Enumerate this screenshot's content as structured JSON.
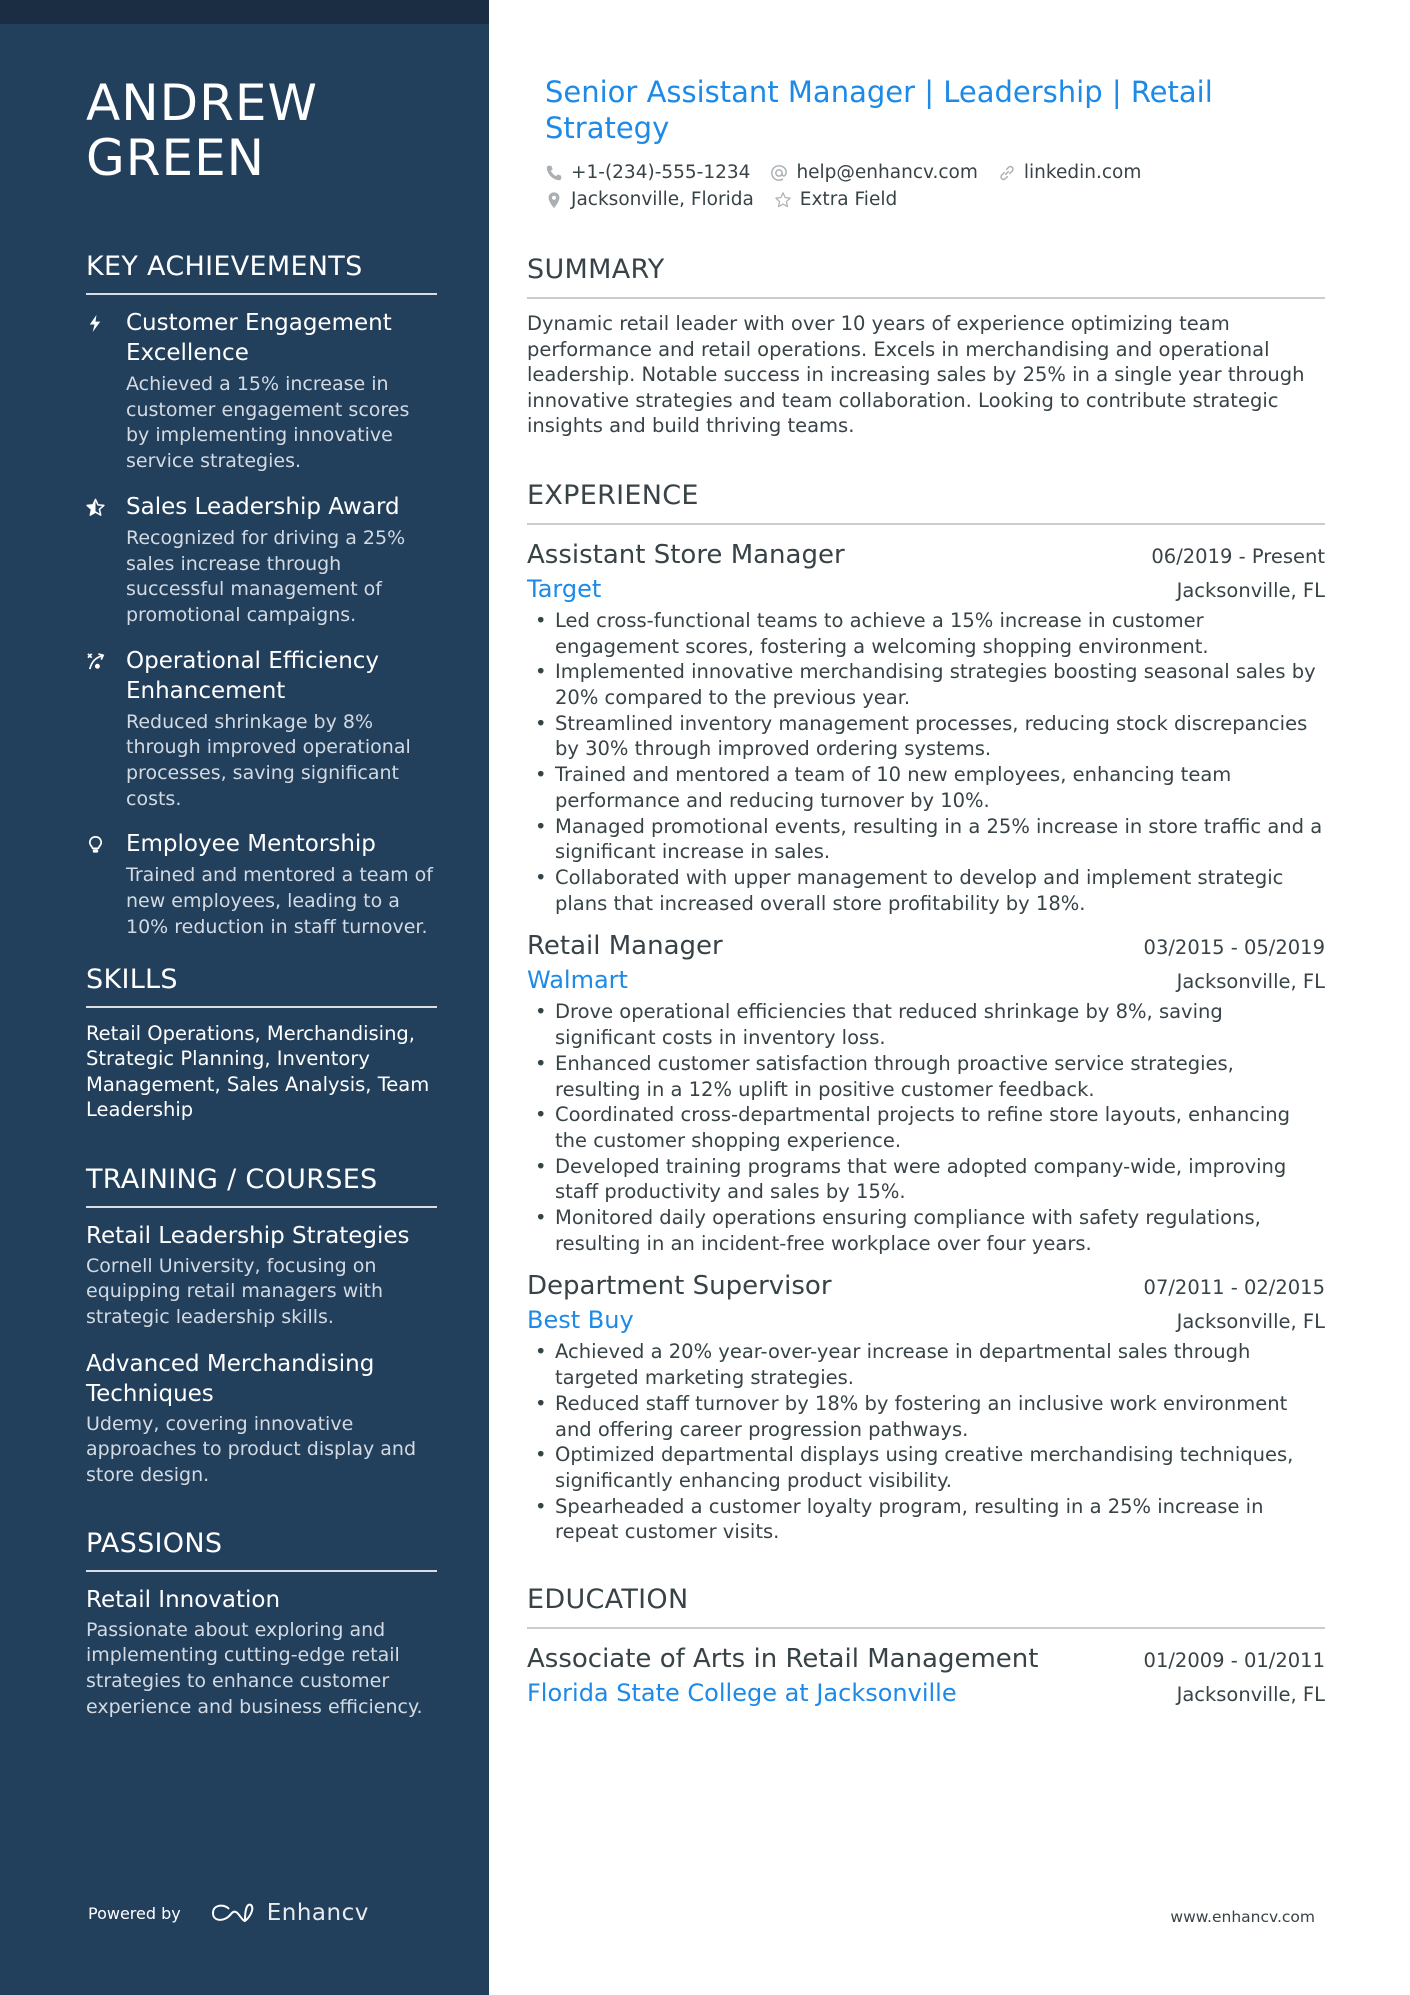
{
  "sidebar": {
    "name_line1": "ANDREW",
    "name_line2": "GREEN",
    "achievements_heading": "KEY ACHIEVEMENTS",
    "achievements": [
      {
        "icon": "lightning-bolt-icon",
        "title": "Customer Engagement Excellence",
        "desc": "Achieved a 15% increase in customer engagement scores by implementing innovative service strategies."
      },
      {
        "icon": "star-half-icon",
        "title": "Sales Leadership Award",
        "desc": "Recognized for driving a 25% sales increase through successful management of promotional campaigns."
      },
      {
        "icon": "strategy-arrow-icon",
        "title": "Operational Efficiency Enhancement",
        "desc": "Reduced shrinkage by 8% through improved operational processes, saving significant costs."
      },
      {
        "icon": "lightbulb-icon",
        "title": "Employee Mentorship",
        "desc": "Trained and mentored a team of new employees, leading to a 10% reduction in staff turnover."
      }
    ],
    "skills_heading": "SKILLS",
    "skills_text": "Retail Operations, Merchandising, Strategic Planning, Inventory Management, Sales Analysis, Team Leadership",
    "training_heading": "TRAINING / COURSES",
    "courses": [
      {
        "title": "Retail Leadership Strategies",
        "desc": "Cornell University, focusing on equipping retail managers with strategic leadership skills."
      },
      {
        "title": "Advanced Merchandising Techniques",
        "desc": "Udemy, covering innovative approaches to product display and store design."
      }
    ],
    "passions_heading": "PASSIONS",
    "passions": [
      {
        "title": "Retail Innovation",
        "desc": "Passionate about exploring and implementing cutting-edge retail strategies to enhance customer experience and business efficiency."
      }
    ],
    "powered_by": "Powered by",
    "brand": "Enhancv"
  },
  "header": {
    "headline": "Senior Assistant Manager | Leadership | Retail Strategy",
    "contacts": {
      "phone": "+1-(234)-555-1234",
      "email": "help@enhancv.com",
      "link": "linkedin.com",
      "location": "Jacksonville, Florida",
      "extra": "Extra Field"
    }
  },
  "summary": {
    "heading": "SUMMARY",
    "text": "Dynamic retail leader with over 10 years of experience optimizing team performance and retail operations. Excels in merchandising and operational leadership. Notable success in increasing sales by 25% in a single year through innovative strategies and team collaboration. Looking to contribute strategic insights and build thriving teams."
  },
  "experience": {
    "heading": "EXPERIENCE",
    "jobs": [
      {
        "title": "Assistant Store Manager",
        "dates": "06/2019 - Present",
        "company": "Target",
        "location": "Jacksonville, FL",
        "bullets": [
          "Led cross-functional teams to achieve a 15% increase in customer engagement scores, fostering a welcoming shopping environment.",
          "Implemented innovative merchandising strategies boosting seasonal sales by 20% compared to the previous year.",
          "Streamlined inventory management processes, reducing stock discrepancies by 30% through improved ordering systems.",
          "Trained and mentored a team of 10 new employees, enhancing team performance and reducing turnover by 10%.",
          "Managed promotional events, resulting in a 25% increase in store traffic and a significant increase in sales.",
          "Collaborated with upper management to develop and implement strategic plans that increased overall store profitability by 18%."
        ]
      },
      {
        "title": "Retail Manager",
        "dates": "03/2015 - 05/2019",
        "company": "Walmart",
        "location": "Jacksonville, FL",
        "bullets": [
          "Drove operational efficiencies that reduced shrinkage by 8%, saving significant costs in inventory loss.",
          "Enhanced customer satisfaction through proactive service strategies, resulting in a 12% uplift in positive customer feedback.",
          "Coordinated cross-departmental projects to refine store layouts, enhancing the customer shopping experience.",
          "Developed training programs that were adopted company-wide, improving staff productivity and sales by 15%.",
          "Monitored daily operations ensuring compliance with safety regulations, resulting in an incident-free workplace over four years."
        ]
      },
      {
        "title": "Department Supervisor",
        "dates": "07/2011 - 02/2015",
        "company": "Best Buy",
        "location": "Jacksonville, FL",
        "bullets": [
          "Achieved a 20% year-over-year increase in departmental sales through targeted marketing strategies.",
          "Reduced staff turnover by 18% by fostering an inclusive work environment and offering career progression pathways.",
          "Optimized departmental displays using creative merchandising techniques, significantly enhancing product visibility.",
          "Spearheaded a customer loyalty program, resulting in a 25% increase in repeat customer visits."
        ]
      }
    ]
  },
  "education": {
    "heading": "EDUCATION",
    "items": [
      {
        "degree": "Associate of Arts in Retail Management",
        "dates": "01/2009 - 01/2011",
        "school": "Florida State College at Jacksonville",
        "location": "Jacksonville, FL"
      }
    ]
  },
  "footer": {
    "site": "www.enhancv.com"
  },
  "colors": {
    "sidebar": "#223f5c",
    "sidebar_top": "#1a2d43",
    "accent": "#1d8ae8",
    "text": "#384347"
  }
}
